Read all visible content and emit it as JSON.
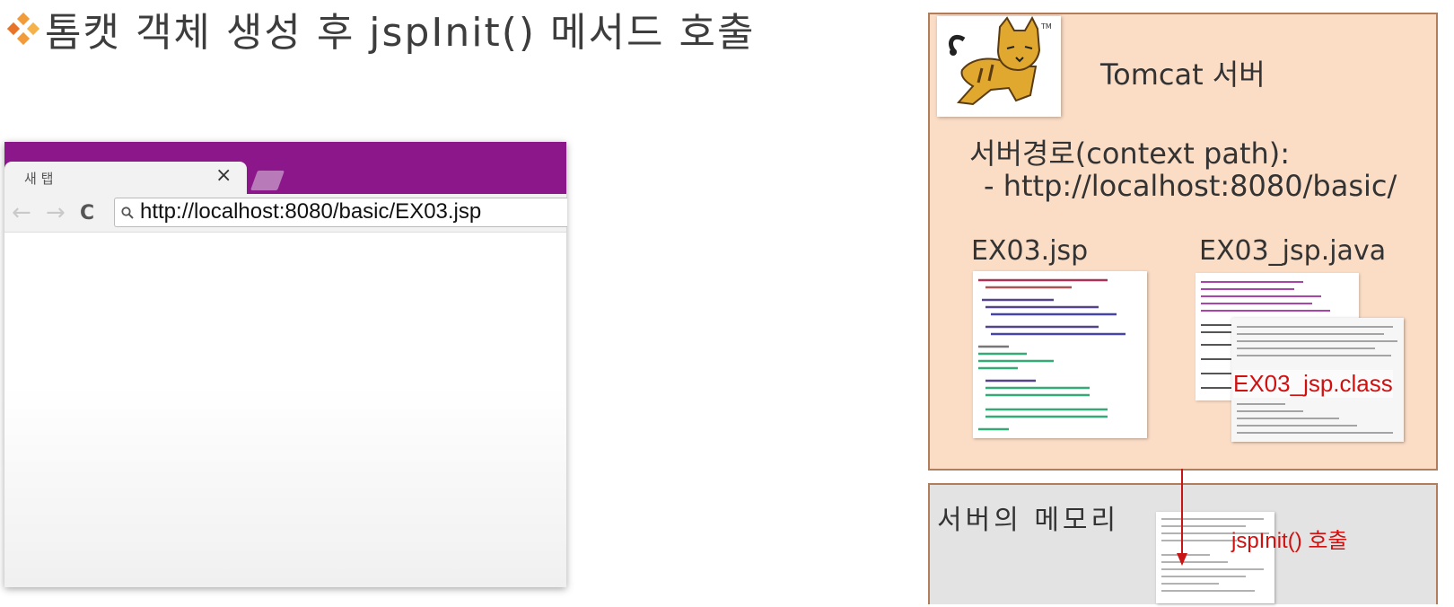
{
  "title": "❖톰캣 객체 생성 후 jspInit() 메서드 호출",
  "title_text": "톰캣 객체 생성 후 jspInit() 메서드 호출",
  "browser": {
    "tab_label": "새 탭",
    "tab_close": "×",
    "back": "←",
    "forward": "→",
    "reload": "C",
    "url": "http://localhost:8080/basic/EX03.jsp",
    "frame_color": "#8b178b"
  },
  "server": {
    "title": "Tomcat 서버",
    "context_label": "서버경로(context path):",
    "context_url": "- http://localhost:8080/basic/",
    "file_jsp": "EX03.jsp",
    "file_java": "EX03_jsp.java",
    "file_class": "EX03_jsp.class",
    "bg_color": "#fbddc6"
  },
  "memory": {
    "label": "서버의 메모리",
    "call_label": "jspInit() 호출",
    "bg_color": "#e3e3e3"
  },
  "accent_red": "#d11010",
  "icons": [
    "diamond-icon",
    "tomcat-logo-icon",
    "search-icon",
    "close-icon",
    "back-arrow-icon",
    "forward-arrow-icon",
    "reload-icon",
    "arrow-down-icon"
  ]
}
